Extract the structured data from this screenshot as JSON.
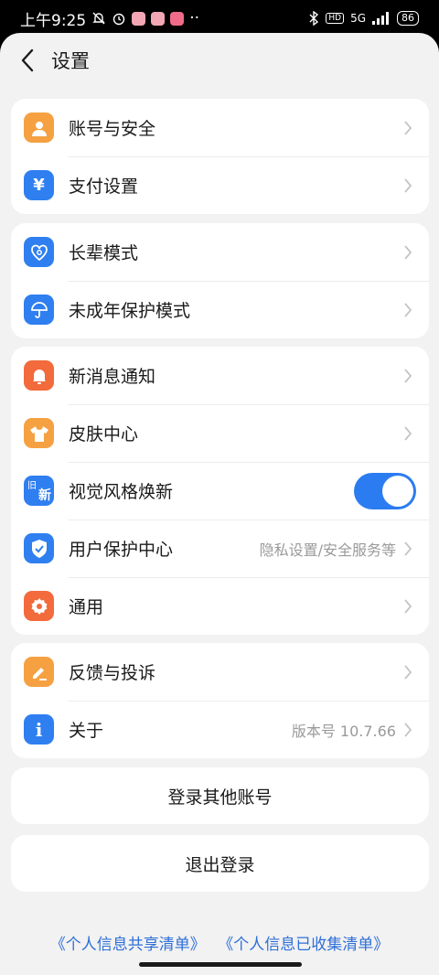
{
  "status_bar": {
    "time": "上午9:25",
    "network": "5G",
    "battery": "86"
  },
  "header": {
    "title": "设置"
  },
  "groups": [
    [
      {
        "label": "账号与安全",
        "icon": "user-icon",
        "color": "#f5a142"
      },
      {
        "label": "支付设置",
        "icon": "yuan-icon",
        "color": "#2f7ff0"
      }
    ],
    [
      {
        "label": "长辈模式",
        "icon": "heart-icon",
        "color": "#2f7ff0"
      },
      {
        "label": "未成年保护模式",
        "icon": "umbrella-icon",
        "color": "#2f7ff0"
      }
    ],
    [
      {
        "label": "新消息通知",
        "icon": "bell-icon",
        "color": "#f36a3c"
      },
      {
        "label": "皮肤中心",
        "icon": "shirt-icon",
        "color": "#f5a142"
      },
      {
        "label": "视觉风格焕新",
        "icon": "old-new-icon",
        "color": "#2f7ff0",
        "toggle": true
      },
      {
        "label": "用户保护中心",
        "hint": "隐私设置/安全服务等",
        "icon": "shield-icon",
        "color": "#2f7ff0"
      },
      {
        "label": "通用",
        "icon": "gear-icon",
        "color": "#f36a3c"
      }
    ],
    [
      {
        "label": "反馈与投诉",
        "icon": "pencil-icon",
        "color": "#f5a142"
      },
      {
        "label": "关于",
        "hint": "版本号 10.7.66",
        "icon": "info-icon",
        "color": "#2f7ff0"
      }
    ]
  ],
  "icon_text": {
    "yuan": "¥",
    "old": "旧",
    "new": "新",
    "info": "i"
  },
  "buttons": {
    "switch_account": "登录其他账号",
    "logout": "退出登录"
  },
  "links": {
    "shared_list": "《个人信息共享清单》",
    "collected_list": "《个人信息已收集清单》"
  }
}
